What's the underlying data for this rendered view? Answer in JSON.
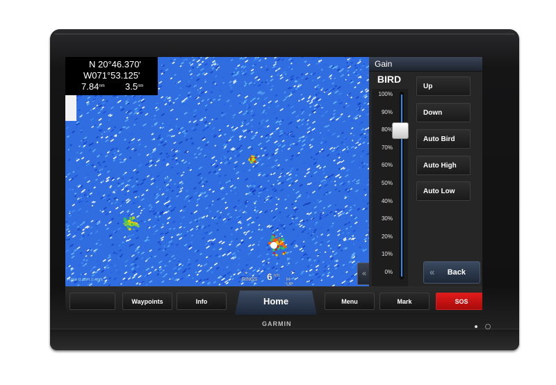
{
  "device": {
    "brand": "GARMIN"
  },
  "position": {
    "lat": "N  20°46.370'",
    "lon": "W071°53.125'",
    "left_value": "7.84",
    "left_unit": "nm",
    "right_value": "3.5",
    "right_unit": "nm"
  },
  "radar_overlay": {
    "rings_label": "RINGS",
    "range_value": "6",
    "range_unit": "nm",
    "orientation_label": "H-UP",
    "scale_text": "Pulse 0.2nm 0.4nm"
  },
  "gain_panel": {
    "title": "Gain",
    "mode": "BIRD",
    "gain_percent": 80,
    "ticks": [
      "100%",
      "90%",
      "80%",
      "70%",
      "60%",
      "50%",
      "40%",
      "30%",
      "20%",
      "10%",
      "0%"
    ],
    "buttons": [
      "Up",
      "Down",
      "Auto Bird",
      "Auto High",
      "Auto Low"
    ],
    "back_label": "Back",
    "back_chevron": "«",
    "collapse_chevron": "«"
  },
  "toolbar": {
    "blank_label": "",
    "waypoints_label": "Waypoints",
    "info_label": "Info",
    "home_label": "Home",
    "menu_label": "Menu",
    "mark_label": "Mark",
    "sos_label": "SOS"
  },
  "colors": {
    "sonar_base": "#2f6de0",
    "sos": "#d01414",
    "slider_fill": "#2a8ef0"
  }
}
